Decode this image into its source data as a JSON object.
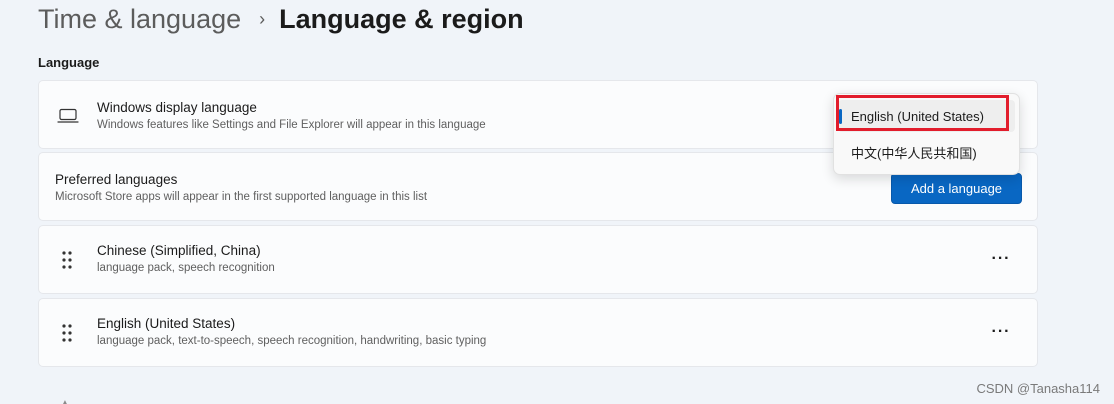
{
  "breadcrumb": {
    "parent": "Time & language",
    "separator": "›",
    "current": "Language & region"
  },
  "section": {
    "title": "Language"
  },
  "display_language": {
    "icon": "laptop-icon",
    "title": "Windows display language",
    "description": "Windows features like Settings and File Explorer will appear in this language"
  },
  "dropdown": {
    "options": [
      "English (United States)",
      "中文(中华人民共和国)"
    ],
    "selected_index": 0,
    "accent_color": "#0967c3",
    "highlight_color": "#e21d2c"
  },
  "preferred": {
    "title": "Preferred languages",
    "description": "Microsoft Store apps will appear in the first supported language in this list",
    "add_button": "Add a language"
  },
  "languages": [
    {
      "name": "Chinese (Simplified, China)",
      "features": "language pack, speech recognition",
      "more": "···"
    },
    {
      "name": "English (United States)",
      "features": "language pack, text-to-speech, speech recognition, handwriting, basic typing",
      "more": "···"
    }
  ],
  "watermark": "CSDN @Tanasha114"
}
